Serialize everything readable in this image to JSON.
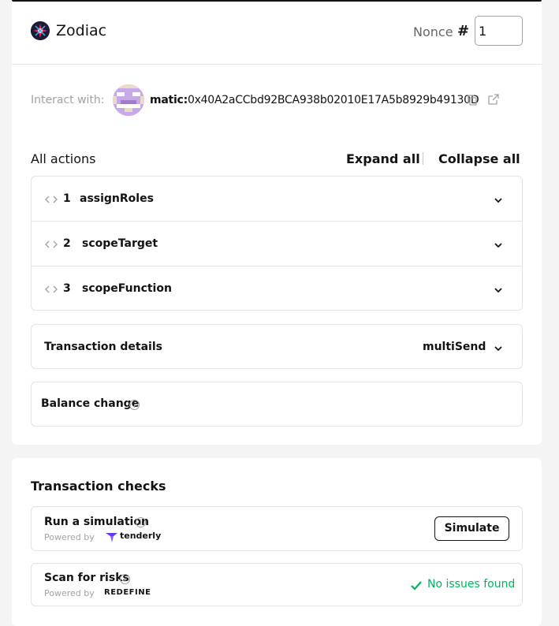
{
  "header": {
    "app_name": "Zodiac",
    "nonce_label": "Nonce",
    "nonce_hash": "#",
    "nonce_value": "1"
  },
  "interact": {
    "label": "Interact with:",
    "address_prefix": "matic:",
    "address": "0x40A2aCCbd92BCA938b02010E17A5b8929b49130D",
    "icons": [
      "copy-icon",
      "external-link-icon"
    ]
  },
  "actions": {
    "title": "All actions",
    "expand_label": "Expand all",
    "collapse_label": "Collapse all",
    "items": [
      {
        "num": "1",
        "name": "assignRoles"
      },
      {
        "num": "2",
        "name": "scopeTarget"
      },
      {
        "num": "3",
        "name": "scopeFunction"
      }
    ]
  },
  "transaction_details": {
    "title": "Transaction details",
    "value": "multiSend"
  },
  "balance_change": {
    "title": "Balance change"
  },
  "checks": {
    "title": "Transaction checks",
    "simulation": {
      "title": "Run a simulation",
      "powered_by": "Powered by",
      "provider": "tenderly",
      "button": "Simulate"
    },
    "risk": {
      "title": "Scan for risks",
      "powered_by": "Powered by",
      "provider": "REDEFINE",
      "status": "No issues found"
    }
  },
  "colors": {
    "text": "#121312",
    "muted": "#a1a3a7",
    "border": "#e4e4e4",
    "success": "#00b460",
    "background": "#f4f4f4"
  }
}
